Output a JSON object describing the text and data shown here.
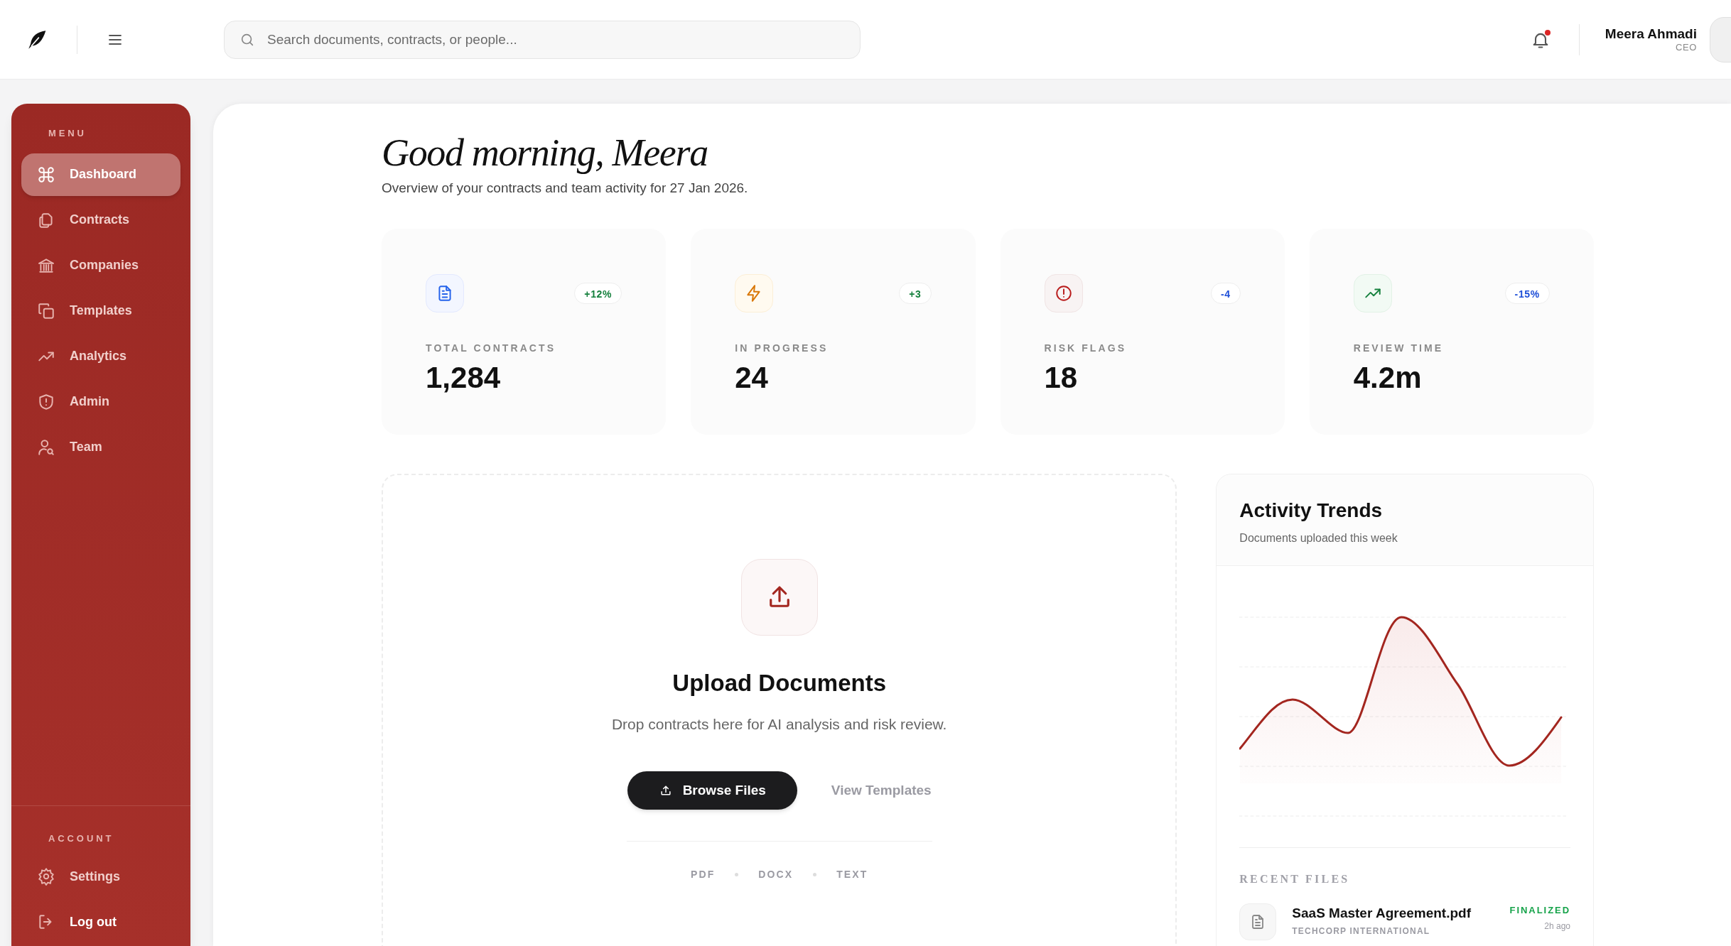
{
  "search": {
    "placeholder": "Search documents, contracts, or people..."
  },
  "notifications": {
    "unread": true
  },
  "user": {
    "name": "Meera Ahmadi",
    "role": "CEO"
  },
  "sidebar": {
    "menu_label": "MENU",
    "items": [
      {
        "label": "Dashboard",
        "kind": "command",
        "selected": true
      },
      {
        "label": "Contracts",
        "kind": "files",
        "selected": false
      },
      {
        "label": "Companies",
        "kind": "bank",
        "selected": false
      },
      {
        "label": "Templates",
        "kind": "copy",
        "selected": false
      },
      {
        "label": "Analytics",
        "kind": "trend",
        "selected": false
      },
      {
        "label": "Admin",
        "kind": "shield",
        "selected": false
      },
      {
        "label": "Team",
        "kind": "user-search",
        "selected": false
      }
    ],
    "account_label": "ACCOUNT",
    "account_items": [
      {
        "label": "Settings",
        "kind": "gear"
      },
      {
        "label": "Log out",
        "kind": "logout"
      }
    ]
  },
  "greeting": {
    "title": "Good morning, Meera",
    "subtitle": "Overview of your contracts and team activity for 27 Jan 2026."
  },
  "stats": [
    {
      "kind": "document",
      "label": "TOTAL CONTRACTS",
      "value": "1,284",
      "change": "+12%",
      "color": "#15803d"
    },
    {
      "kind": "bolt",
      "label": "IN PROGRESS",
      "value": "24",
      "change": "+3",
      "color": "#15803d"
    },
    {
      "kind": "alert",
      "label": "RISK FLAGS",
      "value": "18",
      "change": "-4",
      "color": "#1d4ed8"
    },
    {
      "kind": "trend",
      "label": "REVIEW TIME",
      "value": "4.2m",
      "change": "-15%",
      "color": "#1d4ed8"
    }
  ],
  "upload": {
    "title": "Upload Documents",
    "subtitle": "Drop contracts here for AI analysis and risk review.",
    "primary_button": "Browse Files",
    "secondary_button": "View Templates",
    "formats": [
      "PDF",
      "DOCX",
      "TEXT"
    ]
  },
  "activity": {
    "title": "Activity Trends",
    "subtitle": "Documents uploaded this week",
    "recent_label": "RECENT FILES",
    "files": [
      {
        "name": "SaaS Master Agreement.pdf",
        "company": "TECHCORP INTERNATIONAL",
        "status": "FINALIZED",
        "time": "2h ago"
      }
    ]
  }
}
